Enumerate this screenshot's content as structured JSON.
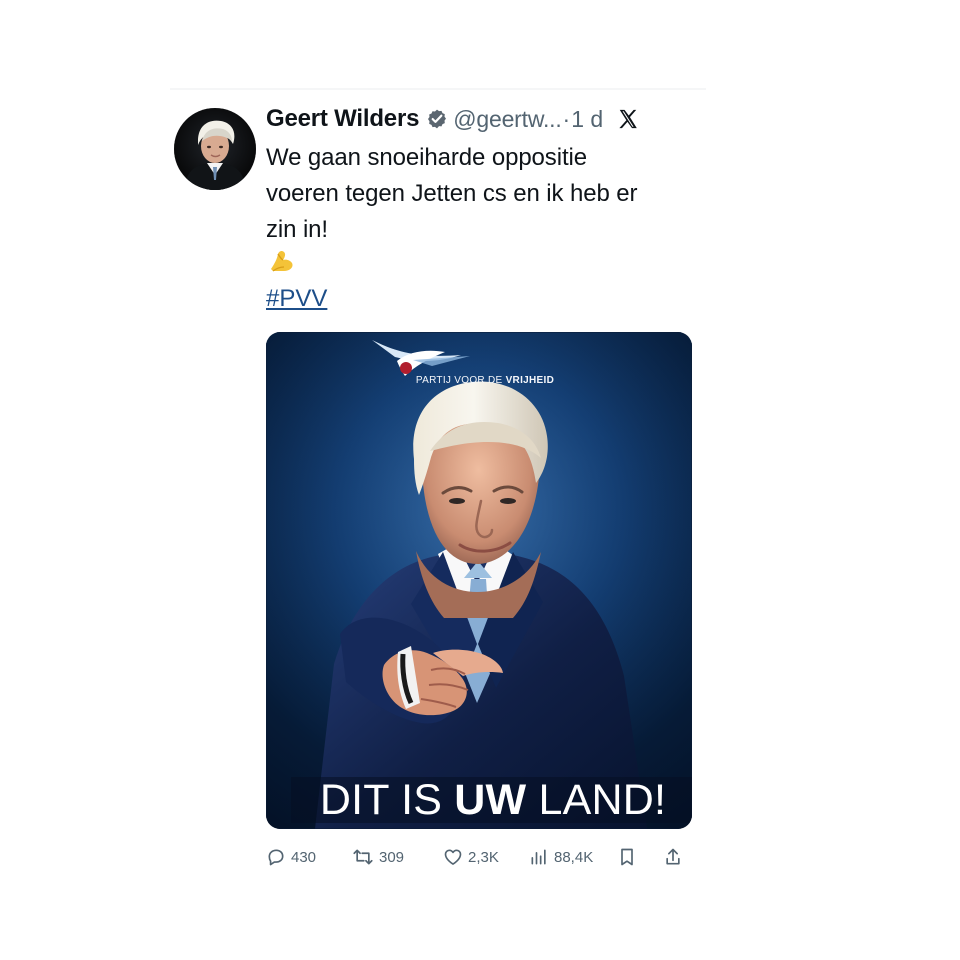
{
  "tweet": {
    "author_name": "Geert Wilders",
    "handle": "@geertw...",
    "separator": "·",
    "time": "1 d",
    "text_lines": [
      "We gaan snoeiharde oppositie",
      "voeren tegen Jetten cs en ik heb er",
      "zin in!"
    ],
    "emoji": "💪",
    "hashtag": "#PVV"
  },
  "media": {
    "party_text_prefix": "PARTIJ VOOR DE ",
    "party_text_strong": "VRIJHEID",
    "slogan_part_1": "DIT IS ",
    "slogan_part_2": "UW",
    "slogan_part_3": " LAND!"
  },
  "metrics": {
    "replies": "430",
    "reposts": "309",
    "likes": "2,3K",
    "views": "88,4K"
  },
  "icons": {
    "verified": "verified-badge-icon",
    "x_logo": "x-logo-icon",
    "reply": "reply-icon",
    "repost": "repost-icon",
    "like": "heart-icon",
    "views": "views-icon",
    "bookmark": "bookmark-icon",
    "share": "share-icon"
  },
  "colors": {
    "text": "#0f1419",
    "secondary": "#536471",
    "link": "#1d4e89",
    "media_background": "#123b6f"
  }
}
